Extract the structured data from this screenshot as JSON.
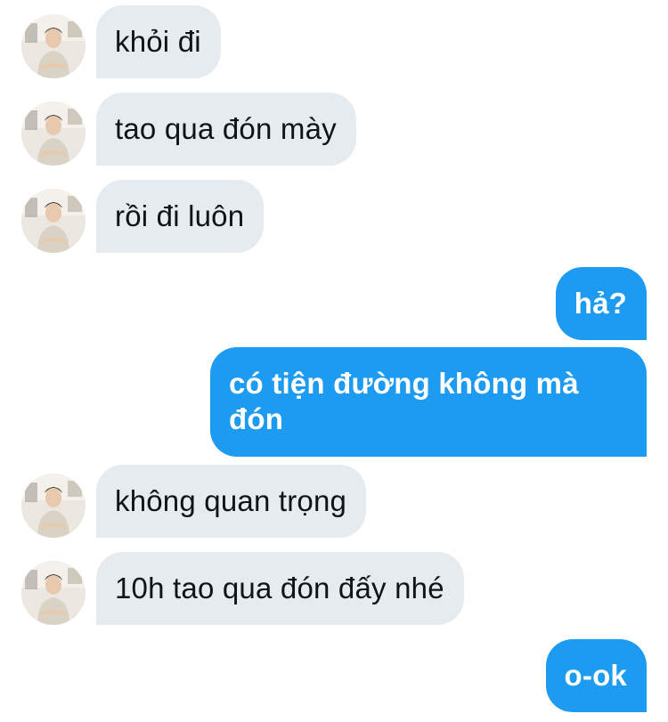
{
  "messages": [
    {
      "side": "received",
      "text": "khỏi đi"
    },
    {
      "side": "received",
      "text": "tao qua đón mày"
    },
    {
      "side": "received",
      "text": "rồi đi luôn"
    },
    {
      "side": "sent",
      "text": "hả?"
    },
    {
      "side": "sent",
      "lines": [
        "có tiện đường không mà",
        "đón"
      ]
    },
    {
      "side": "received",
      "text": "không quan trọng"
    },
    {
      "side": "received",
      "text": "10h tao qua đón đấy nhé"
    },
    {
      "side": "sent",
      "text": "o-ok"
    }
  ],
  "icons": {
    "avatar": "contact-avatar-photo"
  },
  "colors": {
    "received_bubble": "#e6ebef",
    "sent_bubble": "#1d9bf0",
    "received_text": "#0f1419",
    "sent_text": "#ffffff"
  }
}
